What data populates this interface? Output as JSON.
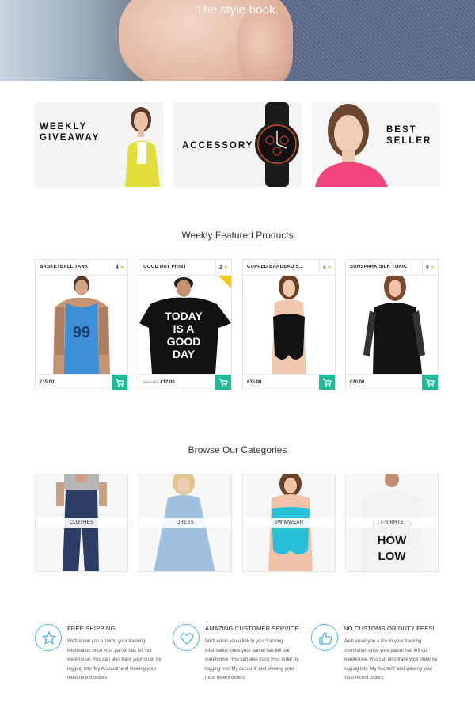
{
  "hero": {
    "title": "The style book."
  },
  "banners": [
    {
      "label_line1": "WEEKLY",
      "label_line2": "GIVEAWAY"
    },
    {
      "label_line1": "ACCESSORY"
    },
    {
      "label_line1": "BEST",
      "label_line2": "SELLER"
    }
  ],
  "featured": {
    "title": "Weekly Featured Products",
    "products": [
      {
        "name": "BASKETBALL TANK",
        "rating": "4",
        "price": "£15.00",
        "old_price": ""
      },
      {
        "name": "GOOD DAY PRINT",
        "rating": "2",
        "price": "£12.00",
        "old_price": "£15.00"
      },
      {
        "name": "CUPPED BANDEAU S...",
        "rating": "4",
        "price": "£35.00",
        "old_price": ""
      },
      {
        "name": "SUNSPARK SILK TUNIC",
        "rating": "0",
        "price": "£20.00",
        "old_price": ""
      }
    ]
  },
  "categories": {
    "title": "Browse Our Categories",
    "items": [
      {
        "label": "CLOTHES"
      },
      {
        "label": "DRESS"
      },
      {
        "label": "SWIMWEAR"
      },
      {
        "label": "T-SHIRTS"
      }
    ]
  },
  "features": [
    {
      "icon": "star-icon",
      "title": "FREE SHIPPING",
      "text": "We'll email you a link to your tracking information once your parcel has left our warehouse. You can also track your order by logging into 'My Account' and viewing your most recent orders."
    },
    {
      "icon": "heart-icon",
      "title": "AMAZING CUSTOMER SERVICE",
      "text": "We'll email you a link to your tracking information once your parcel has left our warehouse. You can also track your order by logging into 'My Account' and viewing your most recent orders."
    },
    {
      "icon": "thumbs-up-icon",
      "title": "NO CUSTOMS OR DUTY FEES!",
      "text": "We'll email you a link to your tracking information once your parcel has left our warehouse. You can also track your order by logging into 'My Account' and viewing your most recent orders."
    }
  ],
  "colors": {
    "accent": "#1fba9a",
    "icon_ring": "#4ab3ec",
    "star": "#f3b820"
  }
}
